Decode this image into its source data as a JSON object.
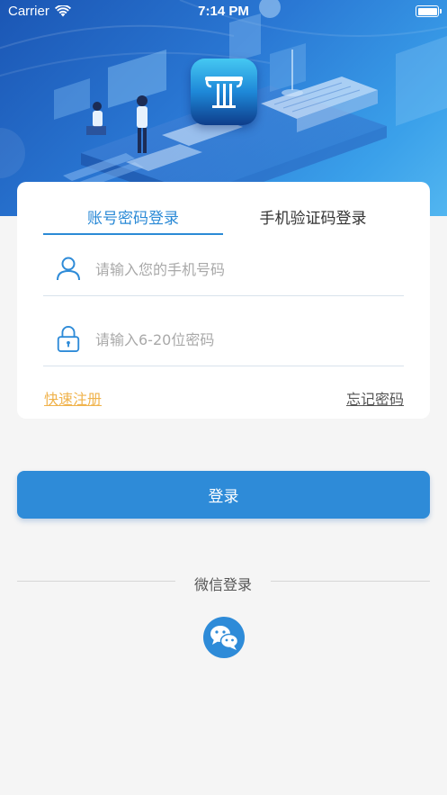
{
  "status_bar": {
    "carrier": "Carrier",
    "time": "7:14 PM"
  },
  "tabs": [
    {
      "label": "账号密码登录",
      "active": true
    },
    {
      "label": "手机验证码登录",
      "active": false
    }
  ],
  "form": {
    "phone_placeholder": "请输入您的手机号码",
    "password_placeholder": "请输入6-20位密码"
  },
  "links": {
    "register": "快速注册",
    "forgot": "忘记密码"
  },
  "login_button": "登录",
  "wechat_section": {
    "label": "微信登录"
  },
  "colors": {
    "accent": "#2e8bd8",
    "register_link": "#f0b34c",
    "background": "#f5f5f5"
  },
  "icons": [
    "wifi-icon",
    "battery-icon",
    "app-logo-icon",
    "user-icon",
    "lock-icon",
    "wechat-icon"
  ]
}
